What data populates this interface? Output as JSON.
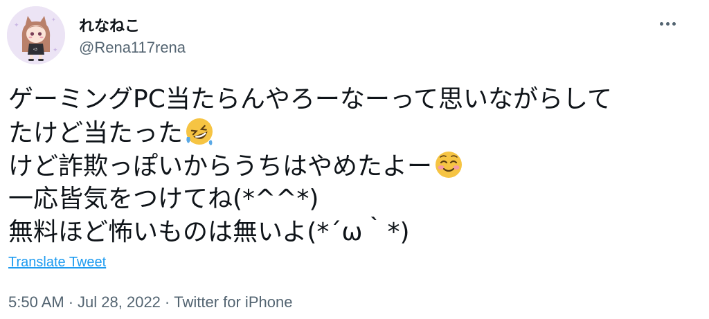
{
  "user": {
    "display_name": "れなねこ",
    "handle": "@Rena117rena",
    "avatar_icon": "avatar-catgirl-icon"
  },
  "more_icon": "more-options-icon",
  "tweet": {
    "line1": "ゲーミングPC当たらんやろーなーって思いながらして",
    "line2": "たけど当たった",
    "line2_emoji": "rolling-on-floor-laughing-emoji",
    "line3": "けど詐欺っぽいからうちはやめたよー",
    "line3_emoji": "smiling-face-emoji",
    "line4": "一応皆気をつけてね(*^^*)",
    "line5": "無料ほど怖いものは無いよ(*´ω｀*)"
  },
  "translate_label": "Translate Tweet",
  "meta": {
    "time": "5:50 AM",
    "date": "Jul 28, 2022",
    "source": "Twitter for iPhone",
    "separator": "·"
  },
  "colors": {
    "link": "#1d9bf0",
    "secondary_text": "#536471",
    "primary_text": "#0f1419"
  }
}
